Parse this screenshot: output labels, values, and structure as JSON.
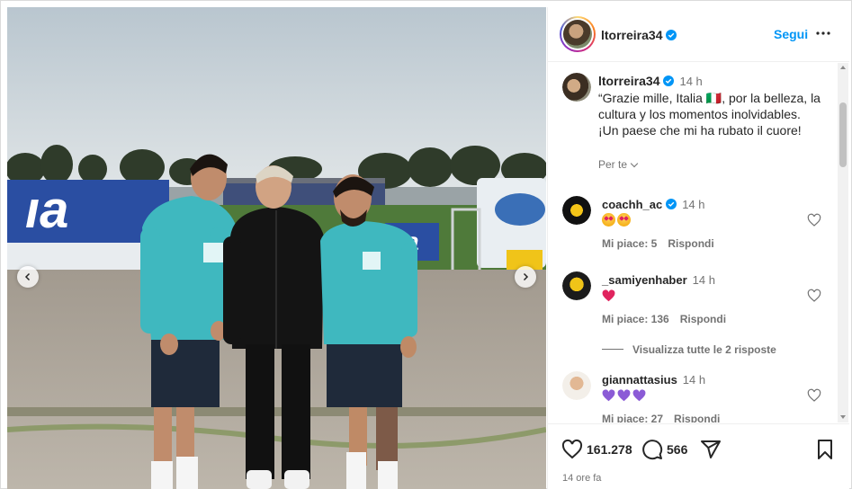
{
  "post": {
    "username": "ltorreira34",
    "follow_label": "Segui",
    "time_ago": "14 h",
    "caption": "“Grazie mille, Italia 🇮🇹, por la belleza, la cultura y los momentos inolvidables.\n¡Un paese che mi ha rubato il cuore!",
    "see_translation": "Per te",
    "likes_count": "161.278",
    "comments_count": "566",
    "posted_ago": "14 ore fa"
  },
  "comments": [
    {
      "username": "coachh_ac",
      "verified": true,
      "time": "14 h",
      "emoji": "face-with-heart-eyes x2",
      "likes": "Mi piace: 5",
      "reply": "Rispondi"
    },
    {
      "username": "_samiyenhaber",
      "verified": false,
      "time": "14 h",
      "emoji": "red-heart",
      "likes": "Mi piace: 136",
      "reply": "Rispondi"
    },
    {
      "username": "giannattasius",
      "verified": false,
      "time": "14 h",
      "emoji": "purple-heart x3",
      "likes": "Mi piace: 27",
      "reply": "Rispondi"
    }
  ],
  "view_replies": "Visualizza tutte le 2 risposte",
  "colors": {
    "accent": "#0095f6",
    "verified": "#0095f6",
    "text": "#262626",
    "muted": "#737373",
    "shirt_teal": "#3fb8bf"
  },
  "icons": [
    "heart-icon",
    "comment-icon",
    "share-icon",
    "bookmark-icon",
    "more-icon",
    "chevron-left-icon",
    "chevron-right-icon",
    "verified-icon"
  ]
}
